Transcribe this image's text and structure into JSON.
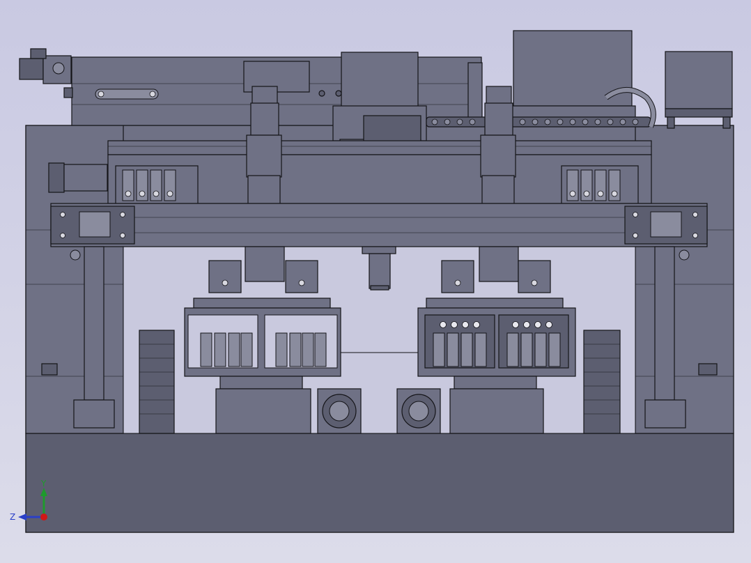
{
  "window": {
    "background_top": "#c9c9e2",
    "background_bottom": "#dcdcea"
  },
  "model": {
    "body_color": "#6f7185",
    "body_dark": "#5c5e70",
    "edge_color": "#141418",
    "light_part": "#8a8c9e"
  },
  "triad": {
    "y_label": "Y",
    "z_label": "Z",
    "x_color": "#d01818",
    "y_color": "#1e9a2c",
    "z_color": "#2a3fc8",
    "icon": "axis-triad-icon"
  }
}
